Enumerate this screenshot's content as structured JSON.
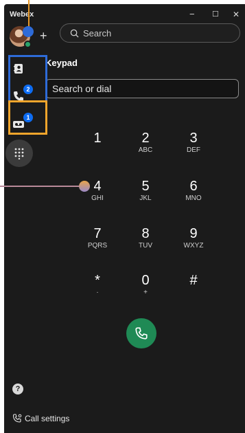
{
  "titlebar": {
    "app_name": "Webex",
    "minimize": "−",
    "maximize": "☐",
    "close": "✕"
  },
  "top": {
    "add_label": "+",
    "search_placeholder": "Search"
  },
  "sidebar": {
    "items": [
      {
        "icon": "contacts-icon",
        "badge": ""
      },
      {
        "icon": "phone-icon",
        "badge": "2"
      },
      {
        "icon": "voicemail-icon",
        "badge": "1"
      },
      {
        "icon": "dialpad-icon",
        "badge": ""
      }
    ],
    "help_label": "?"
  },
  "keypad": {
    "title": "Keypad",
    "input_placeholder": "Search or dial",
    "keys": [
      {
        "digit": "1",
        "letters": ""
      },
      {
        "digit": "2",
        "letters": "ABC"
      },
      {
        "digit": "3",
        "letters": "DEF"
      },
      {
        "digit": "4",
        "letters": "GHI"
      },
      {
        "digit": "5",
        "letters": "JKL"
      },
      {
        "digit": "6",
        "letters": "MNO"
      },
      {
        "digit": "7",
        "letters": "PQRS"
      },
      {
        "digit": "8",
        "letters": "TUV"
      },
      {
        "digit": "9",
        "letters": "WXYZ"
      },
      {
        "digit": "*",
        "letters": "·"
      },
      {
        "digit": "0",
        "letters": "+"
      },
      {
        "digit": "#",
        "letters": ""
      }
    ]
  },
  "footer": {
    "call_settings_label": "Call settings"
  },
  "colors": {
    "background": "#1b1b1b",
    "call_button": "#1f8a55",
    "badge": "#0d6cf2",
    "annotation_blue": "#2e6bd8",
    "annotation_orange": "#f2a52c"
  }
}
